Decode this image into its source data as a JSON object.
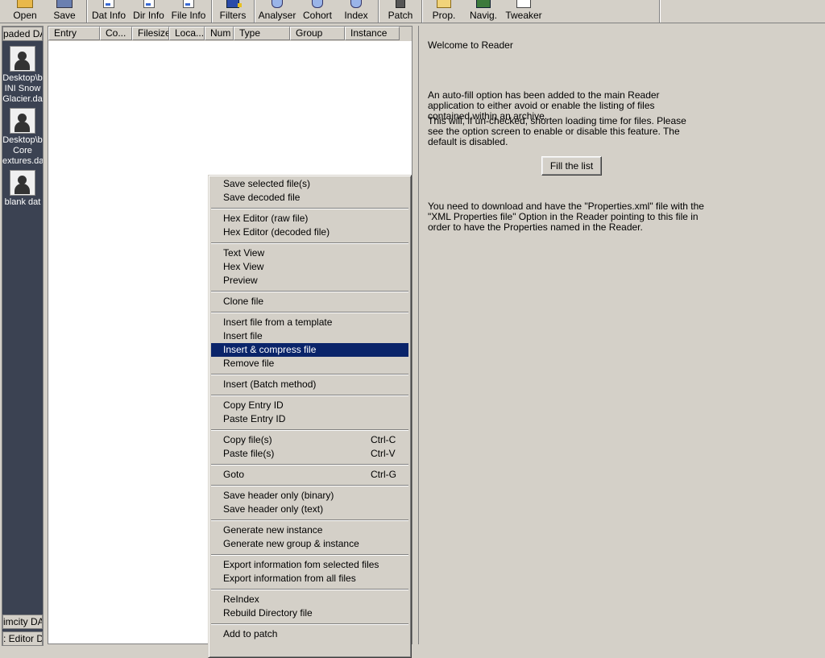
{
  "toolbar": {
    "buttons": [
      {
        "label": "Open",
        "icon": "folder-icon"
      },
      {
        "label": "Save",
        "icon": "disk-icon"
      },
      {
        "label": "Dat Info",
        "icon": "document-icon"
      },
      {
        "label": "Dir Info",
        "icon": "document-icon"
      },
      {
        "label": "File Info",
        "icon": "document-icon"
      },
      {
        "label": "Filters",
        "icon": "filter-icon"
      },
      {
        "label": "Analyser",
        "icon": "magnifier-icon"
      },
      {
        "label": "Cohort",
        "icon": "magnifier-icon"
      },
      {
        "label": "Index",
        "icon": "magnifier-icon"
      },
      {
        "label": "Patch",
        "icon": "patch-icon"
      },
      {
        "label": "Prop.",
        "icon": "properties-icon"
      },
      {
        "label": "Navig.",
        "icon": "navigator-icon"
      },
      {
        "label": "Tweaker",
        "icon": "tweaker-icon"
      }
    ]
  },
  "left_panel": {
    "top_tab": "paded DA",
    "items": [
      {
        "line1": "Desktop\\b",
        "line2": "INI Snow",
        "line3": "Glacier.da"
      },
      {
        "line1": "Desktop\\b",
        "line2": "Core",
        "line3": "extures.da"
      },
      {
        "line1": "blank dat"
      }
    ],
    "bottom_tabs": [
      "imcity DA",
      ": Editor DA"
    ]
  },
  "file_list": {
    "columns": [
      "Entry",
      "Co...",
      "Filesize",
      "Loca...",
      "Num",
      "Type",
      "Group",
      "Instance"
    ]
  },
  "info_panel": {
    "welcome": "Welcome to Reader",
    "para1": "An auto-fill option has been added to the main Reader application to either avoid or enable the listing of files contained within an archive.",
    "para2": "This will, if un-checked, shorten loading time for files. Please see the option screen to enable or disable this feature. The default is disabled.",
    "fill_button": "Fill the list",
    "para3": "You need to download and have the \"Properties.xml\" file with the \"XML Properties file\" Option in the Reader pointing to this file in order to have the Properties named in the Reader."
  },
  "context_menu": {
    "items": [
      {
        "label": "Save selected file(s)"
      },
      {
        "label": "Save decoded file"
      },
      {
        "label": "Hex Editor (raw file)"
      },
      {
        "label": "Hex Editor (decoded file)"
      },
      {
        "label": "Text View"
      },
      {
        "label": "Hex View"
      },
      {
        "label": "Preview"
      },
      {
        "label": "Clone file"
      },
      {
        "label": "Insert file from a template"
      },
      {
        "label": "Insert file"
      },
      {
        "label": "Insert & compress file",
        "selected": true
      },
      {
        "label": "Remove file"
      },
      {
        "label": "Insert (Batch method)"
      },
      {
        "label": "Copy Entry ID"
      },
      {
        "label": "Paste Entry ID"
      },
      {
        "label": "Copy file(s)",
        "shortcut": "Ctrl-C"
      },
      {
        "label": "Paste file(s)",
        "shortcut": "Ctrl-V"
      },
      {
        "label": "Goto",
        "shortcut": "Ctrl-G"
      },
      {
        "label": "Save header only (binary)"
      },
      {
        "label": "Save header only (text)"
      },
      {
        "label": "Generate new instance"
      },
      {
        "label": "Generate new group & instance"
      },
      {
        "label": "Export information fom selected files"
      },
      {
        "label": "Export information from all files"
      },
      {
        "label": "ReIndex"
      },
      {
        "label": "Rebuild Directory file"
      },
      {
        "label": "Add to patch"
      }
    ]
  }
}
